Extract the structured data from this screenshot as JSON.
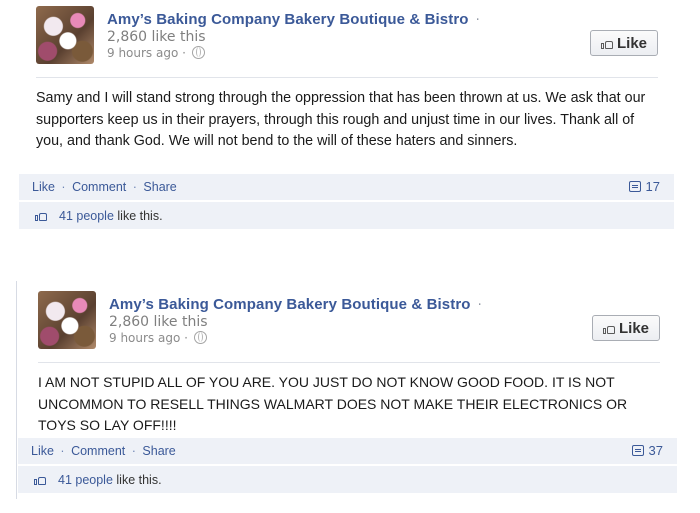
{
  "posts": [
    {
      "page_name": "Amy’s Baking Company Bakery Boutique & Bistro",
      "name_dot": "·",
      "likes_count": "2,860 like this",
      "time": "9 hours ago",
      "time_dot": "·",
      "like_button": "Like",
      "message": "Samy and I will stand strong through the oppression that has been thrown at us. We ask that our supporters keep us in their prayers, through this rough and unjust time in our lives. Thank all of you, and thank God. We will not bend to the will of these haters and sinners.",
      "actions": {
        "like": "Like",
        "comment": "Comment",
        "share": "Share",
        "separator": "·"
      },
      "comment_count": "17",
      "people_count": "41 people",
      "people_suffix": "like this."
    },
    {
      "page_name": "Amy’s Baking Company Bakery Boutique & Bistro",
      "name_dot": "·",
      "likes_count": "2,860 like this",
      "time": "9 hours ago",
      "time_dot": "·",
      "like_button": "Like",
      "message": "I AM NOT STUPID ALL OF YOU ARE. YOU JUST DO NOT KNOW GOOD FOOD. IT IS NOT UNCOMMON TO RESELL THINGS WALMART DOES NOT MAKE THEIR ELECTRONICS OR TOYS SO LAY OFF!!!!",
      "actions": {
        "like": "Like",
        "comment": "Comment",
        "share": "Share",
        "separator": "·"
      },
      "comment_count": "37",
      "people_count": "41 people",
      "people_suffix": "like this."
    }
  ]
}
